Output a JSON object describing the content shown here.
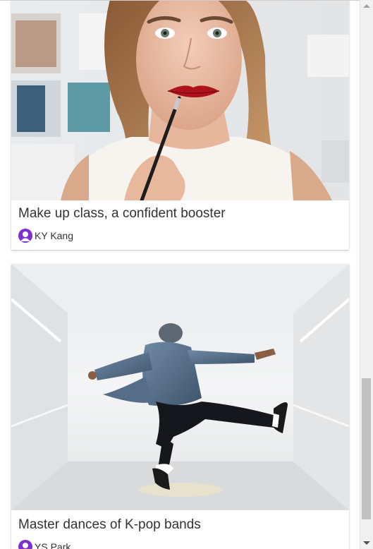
{
  "cards": [
    {
      "image_alt": "woman applying red lipstick with a lip brush",
      "title": "Make up class, a confident booster",
      "author": "KY Kang"
    },
    {
      "image_alt": "dancer leaping in a white room wearing a denim jacket",
      "title": "Master dances of K-pop bands",
      "author": "YS Park"
    }
  ],
  "colors": {
    "avatar": "#7b2fd4",
    "title_text": "#333333",
    "scroll_thumb": "#c1c1c1"
  },
  "icons": {
    "author_avatar": "user-avatar-icon"
  }
}
